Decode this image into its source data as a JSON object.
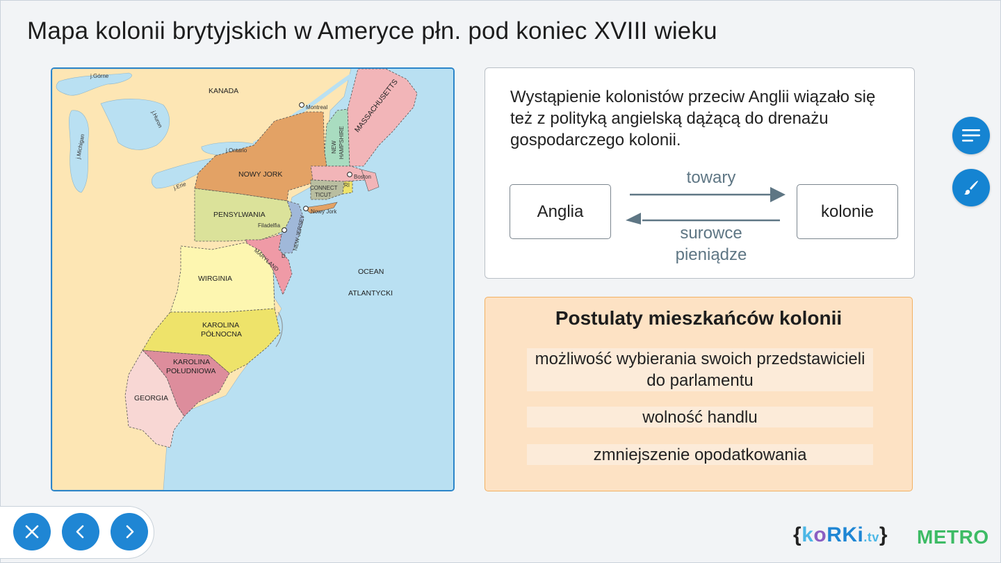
{
  "page": {
    "title": "Mapa kolonii brytyjskich w Ameryce płn. pod koniec XVIII wieku"
  },
  "map": {
    "regions": {
      "canada": "KANADA",
      "new_york": "NOWY JORK",
      "pennsylvania": "PENSYLWANIA",
      "virginia": "WIRGINIA",
      "north_carolina_l1": "KAROLINA",
      "north_carolina_l2": "PÓŁNOCNA",
      "south_carolina_l1": "KAROLINA",
      "south_carolina_l2": "POŁUDNIOWA",
      "georgia": "GEORGIA",
      "massachusetts": "MASSACHUSETTS",
      "new_hampshire_l1": "NEW",
      "new_hampshire_l2": "HAMPSHIRE",
      "connecticut_l1": "CONNECT",
      "connecticut_l2": "TICUT",
      "rhode_island": "RI",
      "new_jersey": "NEW JERSEY",
      "maryland": "MARYLAND",
      "delaware": "D",
      "ocean_l1": "OCEAN",
      "ocean_l2": "ATLANTYCKI"
    },
    "cities": {
      "montreal": "Montreal",
      "boston": "Boston",
      "new_york": "Nowy Jork",
      "philadelphia": "Filadelfia"
    },
    "lakes": {
      "superior": "j.Górne",
      "huron": "j.Huron",
      "michigan": "j.Michigan",
      "ontario": "j.Ontario",
      "erie": "j.Erie"
    },
    "colors": {
      "water": "#b9e0f2",
      "land": "#fde6b4",
      "new_york": "#e3a265",
      "pennsylvania": "#dbe29a",
      "virginia": "#fdf6b0",
      "north_carolina": "#eee36a",
      "south_carolina": "#dd8d9c",
      "georgia": "#f8d7d4",
      "massachusetts": "#f2b5b8",
      "new_hampshire": "#a9dcc0",
      "connecticut": "#b9bea0",
      "new_jersey": "#a0b8d9",
      "maryland": "#ef9aa6"
    }
  },
  "info": {
    "text": "Wystąpienie kolonistów przeciw Anglii wiązało się też z polityką angielską dążącą do drenażu gospodarczego kolonii.",
    "left_box": "Anglia",
    "right_box": "kolonie",
    "top_arrow_label": "towary",
    "bottom_arrow_label_1": "surowce",
    "bottom_arrow_label_2": "pieniądze"
  },
  "postulates": {
    "title": "Postulaty mieszkańców kolonii",
    "items": [
      "możliwość wybierania swoich przedstawicieli do parlamentu",
      "wolność handlu",
      "zmniejszenie opodatkowania"
    ]
  },
  "side_buttons": {
    "notes_icon": "lines-icon",
    "draw_icon": "brush-icon"
  },
  "navigation": {
    "close_icon": "close-icon",
    "prev_icon": "chevron-left-icon",
    "next_icon": "chevron-right-icon"
  },
  "brand": {
    "korki_open": "{",
    "korki_k": "k",
    "korki_o": "o",
    "korki_rk": "RKi",
    "korki_tv": ".tv",
    "korki_close": "}",
    "metro": "METRO",
    "korki_color_1": "#4cb7e6",
    "korki_color_2": "#8b5fc2",
    "korki_color_3": "#1f86d4"
  }
}
